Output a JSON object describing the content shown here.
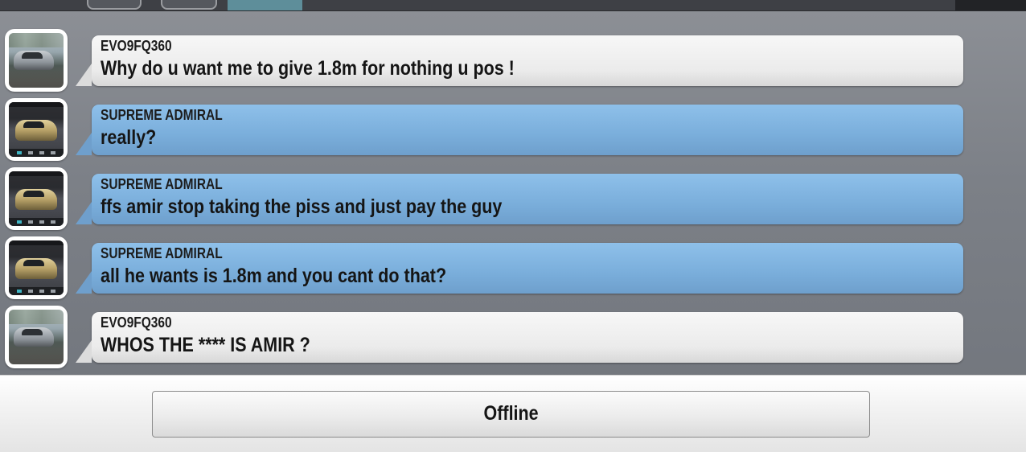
{
  "status_button": {
    "label": "Offline"
  },
  "messages": [
    {
      "sender": "EVO9FQ360",
      "text": "Why do u want me to give 1.8m for nothing u pos !",
      "style": "grey",
      "avatar": "evo"
    },
    {
      "sender": "SUPREME ADMIRAL",
      "text": "really?",
      "style": "blue",
      "avatar": "gold"
    },
    {
      "sender": "SUPREME ADMIRAL",
      "text": "ffs amir stop taking the piss and just pay the guy",
      "style": "blue",
      "avatar": "gold"
    },
    {
      "sender": "SUPREME ADMIRAL",
      "text": "all he wants is 1.8m and you cant do that?",
      "style": "blue",
      "avatar": "gold"
    },
    {
      "sender": "EVO9FQ360",
      "text": "WHOS THE **** IS AMIR ?",
      "style": "grey",
      "avatar": "evo"
    }
  ],
  "colors": {
    "other_bubble": "#ebebeb",
    "own_bubble": "#7aaedb",
    "background": "#7c8087"
  }
}
